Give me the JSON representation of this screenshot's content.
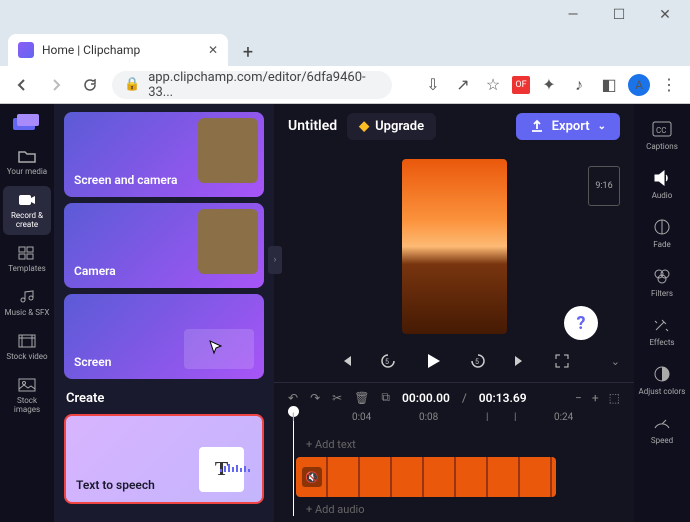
{
  "browser": {
    "tab_title": "Home | Clipchamp",
    "url": "app.clipchamp.com/editor/6dfa9460-33...",
    "avatar_letter": "A"
  },
  "left_rail": [
    {
      "id": "your-media",
      "label": "Your media"
    },
    {
      "id": "record-create",
      "label": "Record & create",
      "active": true
    },
    {
      "id": "templates",
      "label": "Templates"
    },
    {
      "id": "music-sfx",
      "label": "Music & SFX"
    },
    {
      "id": "stock-video",
      "label": "Stock video"
    },
    {
      "id": "stock-images",
      "label": "Stock images"
    }
  ],
  "panel": {
    "tiles": [
      {
        "id": "screen-camera",
        "label": "Screen and camera"
      },
      {
        "id": "camera",
        "label": "Camera"
      },
      {
        "id": "screen",
        "label": "Screen"
      }
    ],
    "create_label": "Create",
    "tts": {
      "label": "Text to speech",
      "glyph": "T"
    }
  },
  "topbar": {
    "title": "Untitled",
    "upgrade": "Upgrade",
    "export": "Export"
  },
  "aspect": "9:16",
  "timecode": {
    "current": "00:00.00",
    "sep": " / ",
    "total": "00:13.69"
  },
  "track_hints": {
    "add_text": "+  Add text",
    "add_audio": "+  Add audio"
  },
  "ruler": [
    "|",
    "0:04",
    "0:08",
    "|",
    "|",
    "0:24"
  ],
  "right_rail": [
    {
      "id": "captions",
      "label": "Captions"
    },
    {
      "id": "audio",
      "label": "Audio"
    },
    {
      "id": "fade",
      "label": "Fade"
    },
    {
      "id": "filters",
      "label": "Filters"
    },
    {
      "id": "effects",
      "label": "Effects"
    },
    {
      "id": "adjust-colors",
      "label": "Adjust colors"
    },
    {
      "id": "speed",
      "label": "Speed"
    }
  ]
}
